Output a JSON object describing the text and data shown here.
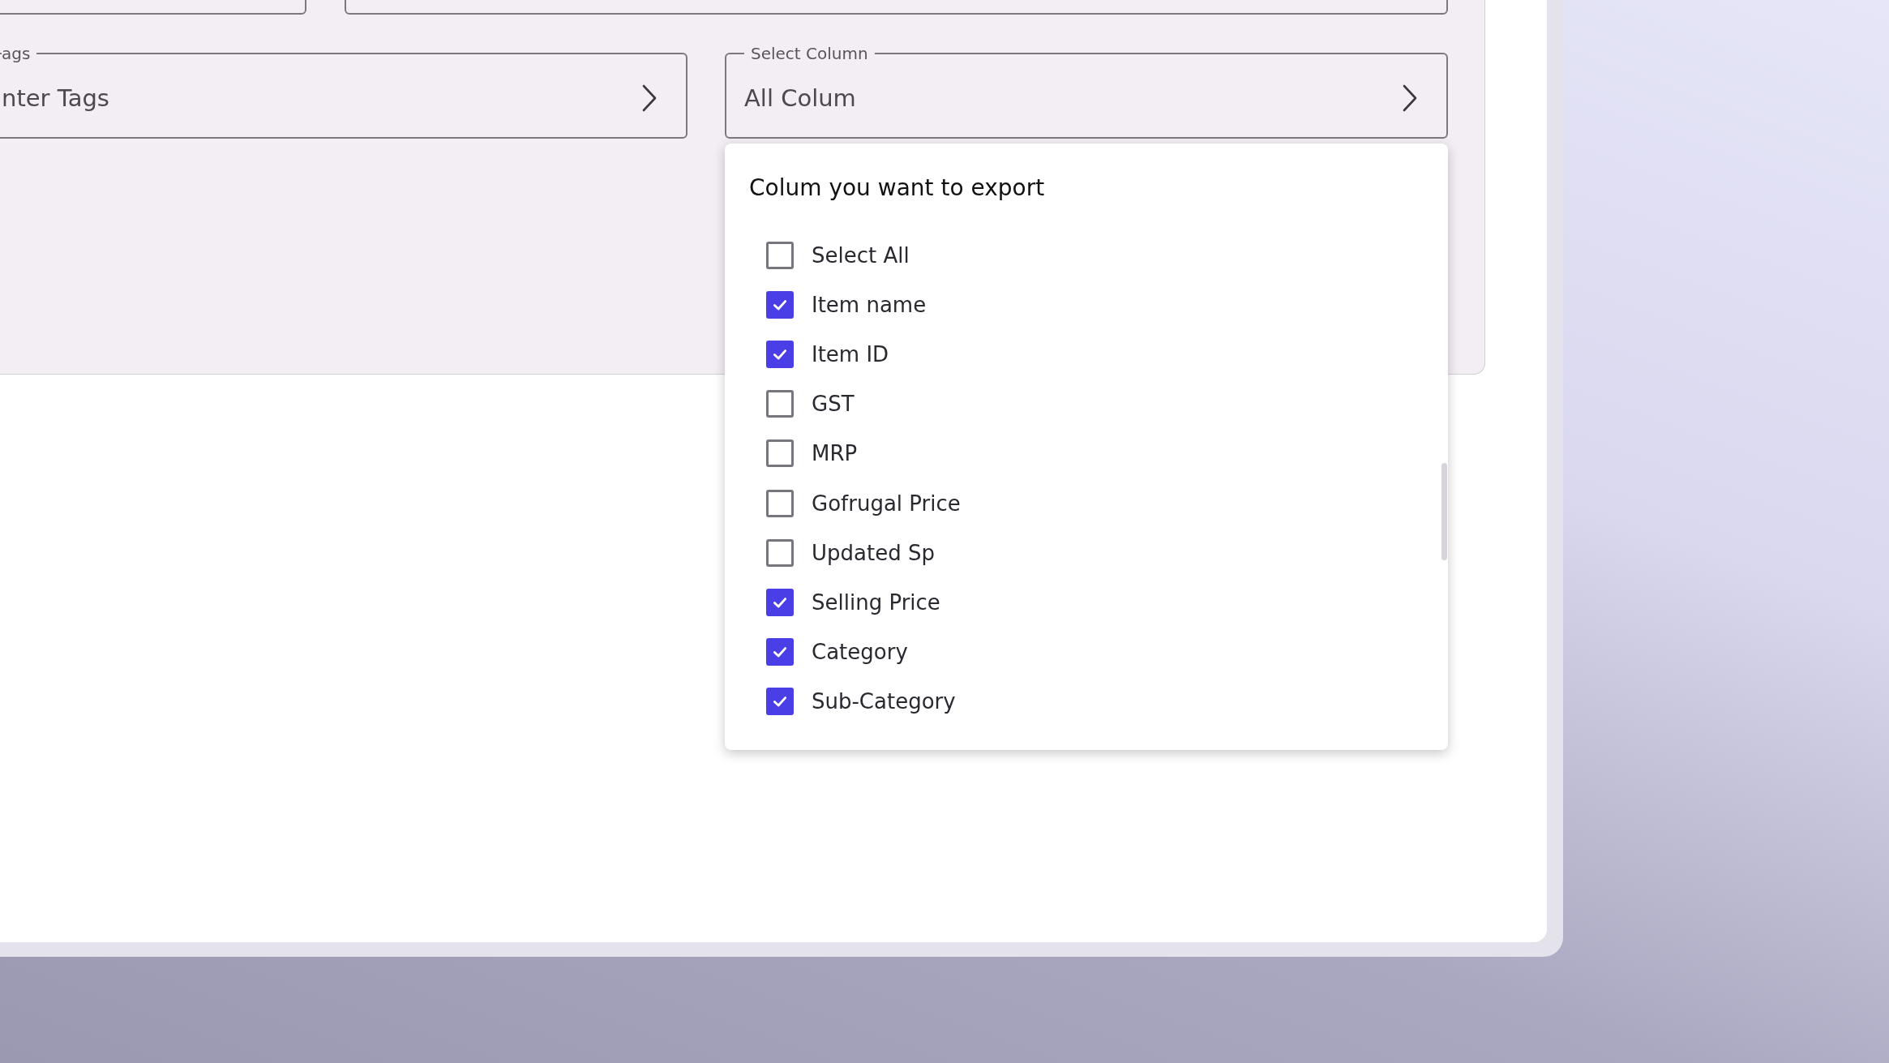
{
  "filters": {
    "tags_field": {
      "label": "ags",
      "placeholder": "nter Tags"
    },
    "column_select": {
      "label": "Select Column",
      "value": "All Colum",
      "expanded": true
    }
  },
  "column_menu": {
    "title": "Colum you want to export",
    "options": [
      {
        "label": "Select All",
        "checked": false
      },
      {
        "label": "Item name",
        "checked": true
      },
      {
        "label": "Item ID",
        "checked": true
      },
      {
        "label": "GST",
        "checked": false
      },
      {
        "label": "MRP",
        "checked": false
      },
      {
        "label": "Gofrugal Price",
        "checked": false
      },
      {
        "label": "Updated Sp",
        "checked": false
      },
      {
        "label": "Selling Price",
        "checked": true
      },
      {
        "label": "Category",
        "checked": true
      },
      {
        "label": "Sub-Category",
        "checked": true
      }
    ]
  }
}
